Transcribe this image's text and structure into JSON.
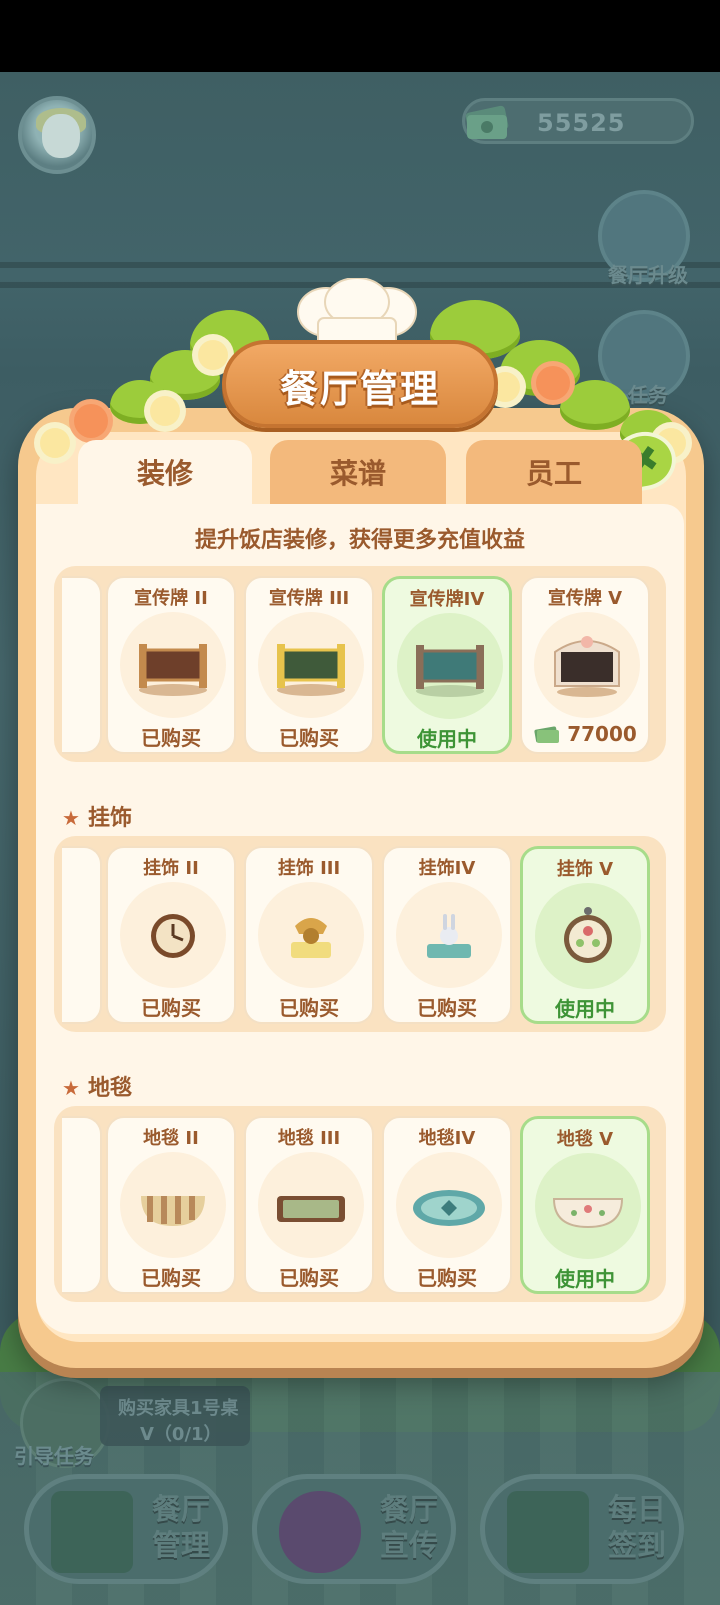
{
  "hud": {
    "coins": "55525",
    "side_upgrade": "餐厅升级",
    "side_tasks": "任务",
    "guide_task_line1": "购买家具1号桌",
    "guide_task_line2": "V（0/1）",
    "guide_label": "引导任务"
  },
  "bottom_nav": [
    {
      "label": "餐厅管理"
    },
    {
      "label": "餐厅宣传"
    },
    {
      "label": "每日签到"
    }
  ],
  "modal": {
    "title": "餐厅管理",
    "tabs": [
      {
        "label": "装修",
        "active": true
      },
      {
        "label": "菜谱",
        "active": false
      },
      {
        "label": "员工",
        "active": false
      }
    ],
    "subtitle": "提升饭店装修，获得更多充值收益",
    "sections": [
      {
        "title": "",
        "items": [
          {
            "name": "宣传牌 II",
            "status": "已购买",
            "icon": "signboard-brown-icon"
          },
          {
            "name": "宣传牌 III",
            "status": "已购买",
            "icon": "signboard-yellow-icon"
          },
          {
            "name": "宣传牌IV",
            "status": "使用中",
            "icon": "signboard-teal-icon"
          },
          {
            "name": "宣传牌 V",
            "price": "77000",
            "icon": "signboard-floral-icon"
          }
        ]
      },
      {
        "title": "挂饰",
        "items": [
          {
            "name": "挂饰 II",
            "status": "已购买",
            "icon": "wall-clock-icon"
          },
          {
            "name": "挂饰 III",
            "status": "已购买",
            "icon": "telephone-icon"
          },
          {
            "name": "挂饰IV",
            "status": "已购买",
            "icon": "rabbit-ornament-icon"
          },
          {
            "name": "挂饰 V",
            "status": "使用中",
            "icon": "floral-plate-icon"
          }
        ]
      },
      {
        "title": "地毯",
        "items": [
          {
            "name": "地毯 II",
            "status": "已购买",
            "icon": "striped-rug-icon"
          },
          {
            "name": "地毯 III",
            "status": "已购买",
            "icon": "green-rug-icon"
          },
          {
            "name": "地毯IV",
            "status": "已购买",
            "icon": "oval-rug-icon"
          },
          {
            "name": "地毯 V",
            "status": "使用中",
            "icon": "floral-rug-icon"
          }
        ]
      }
    ]
  },
  "colors": {
    "panel": "#f6c98e",
    "text_brown": "#9a5a2d",
    "in_use_green": "#3e9436"
  }
}
